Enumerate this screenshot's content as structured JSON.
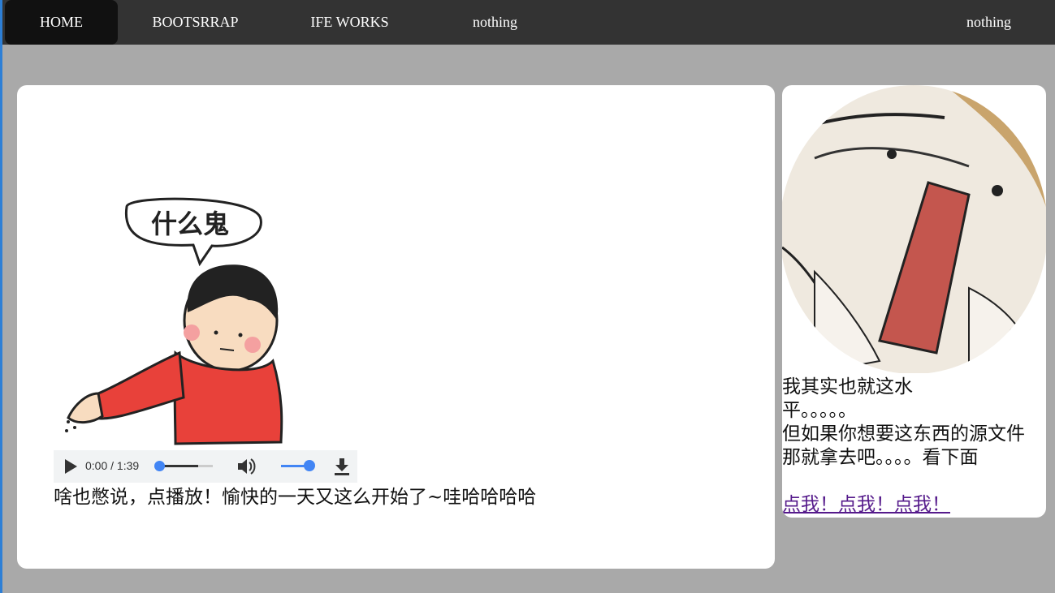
{
  "nav": {
    "items": [
      {
        "label": "HOME",
        "active": true
      },
      {
        "label": "BOOTSRRAP",
        "active": false
      },
      {
        "label": "IFE WORKS",
        "active": false
      },
      {
        "label": "nothing",
        "active": false
      }
    ],
    "right_item": {
      "label": "nothing"
    }
  },
  "main": {
    "meme_bubble_text": "什么鬼",
    "audio": {
      "time": "0:00 / 1:39",
      "progress_fraction": 0.0,
      "volume_fraction": 1.0,
      "icons": [
        "play-icon",
        "volume-icon",
        "download-icon"
      ]
    },
    "caption": "啥也憋说，点播放！愉快的一天又这么开始了~哇哈哈哈哈"
  },
  "side": {
    "line1": "我其实也就这水平。。。。。",
    "line2": "但如果你想要这东西的源文件那就拿去吧。。。。看下面",
    "link": "点我！点我！点我！"
  },
  "colors": {
    "nav_bg": "#333333",
    "nav_active": "#111111",
    "page_bg": "#a9a9a9",
    "card_bg": "#ffffff",
    "accent": "#4285f4",
    "link": "#551a8b"
  }
}
